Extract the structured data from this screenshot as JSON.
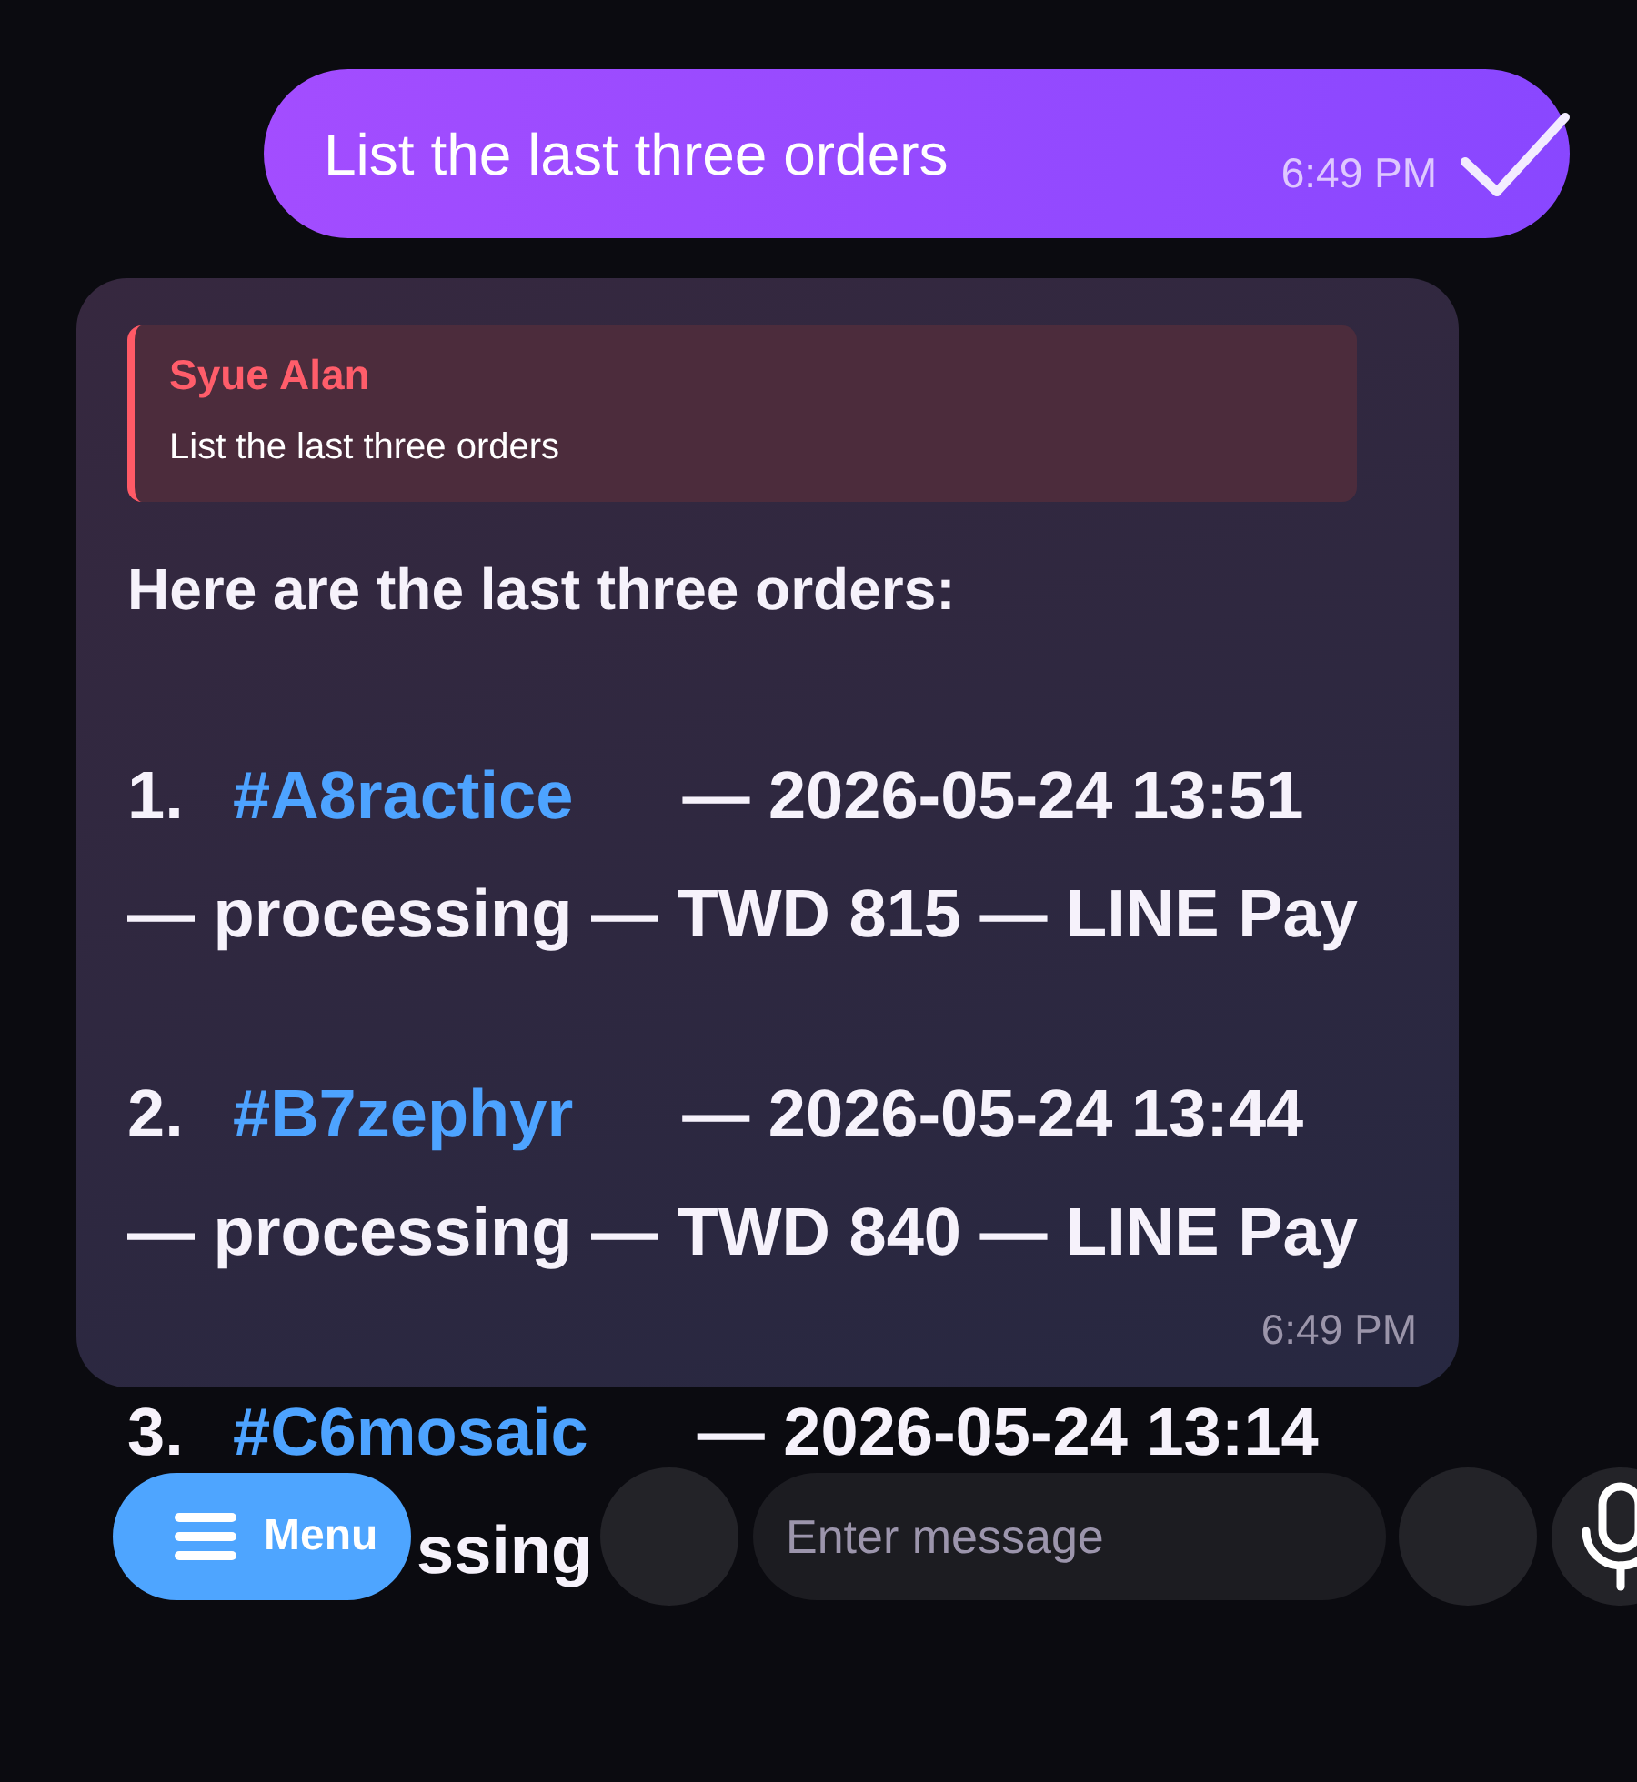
{
  "user_message": {
    "text": "List the last three orders",
    "time": "6:49 PM",
    "read": true
  },
  "reply": {
    "quote": {
      "author": "Syue Alan",
      "text": "List the last three orders"
    },
    "heading": "Here are the last three orders:",
    "orders": [
      {
        "number": "1.",
        "order_id": "#A8ractice",
        "datetime": "— 2026-05-24 13:51",
        "summary": "— processing — TWD 815 — LINE Pay",
        "covered": false
      },
      {
        "number": "2.",
        "order_id": "#B7zephyr",
        "datetime": "— 2026-05-24 13:44",
        "summary": "— processing — TWD 840 — LINE Pay",
        "covered": false
      },
      {
        "number": "3.",
        "order_id": "#C6mosaic",
        "datetime": "— 2026-05-24 13:14",
        "summary": "ssing",
        "covered": true
      }
    ],
    "time": "6:49 PM"
  },
  "composer": {
    "menu_label": "Menu",
    "placeholder": "Enter message"
  }
}
